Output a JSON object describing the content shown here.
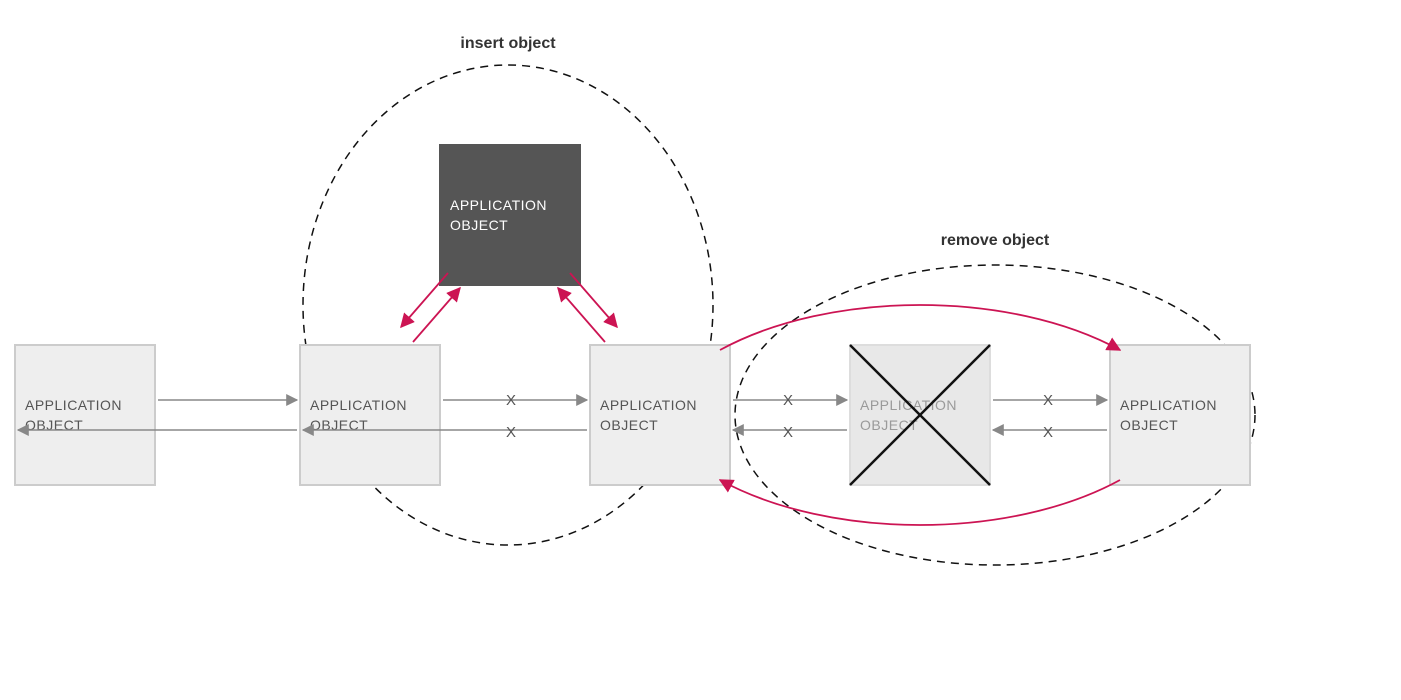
{
  "labels": {
    "insert": "insert object",
    "remove": "remove object",
    "node1_l1": "APPLICATION",
    "node1_l2": "OBJECT",
    "node2_l1": "APPLICATION",
    "node2_l2": "OBJECT",
    "node3_l1": "APPLICATION",
    "node3_l2": "OBJECT",
    "node4_l1": "APPLICATION",
    "node4_l2": "OBJECT",
    "node5_l1": "APPLICATION",
    "node5_l2": "OBJECT",
    "nodeNew_l1": "APPLICATION",
    "nodeNew_l2": "OBJECT",
    "nodeDel_l1": "APPLICATION",
    "nodeDel_l2": "OBJECT"
  },
  "marks": {
    "x": "X"
  },
  "colors": {
    "nodeFill": "#eeeeee",
    "nodeStroke": "#cccccc",
    "nodeDarkFill": "#555555",
    "nodeDeletedFill": "#e8e8e8",
    "arrowGray": "#888888",
    "arrowRed": "#cc1453",
    "dash": "#111111"
  },
  "diagram": {
    "description": "Doubly-linked list of application objects showing insert and remove operations.",
    "nodes": [
      {
        "id": "n1",
        "kind": "normal"
      },
      {
        "id": "n2",
        "kind": "normal"
      },
      {
        "id": "nNew",
        "kind": "inserted"
      },
      {
        "id": "n3",
        "kind": "normal"
      },
      {
        "id": "nDel",
        "kind": "removed"
      },
      {
        "id": "n5",
        "kind": "normal"
      }
    ],
    "links": [
      {
        "from": "n1",
        "to": "n2",
        "state": "active"
      },
      {
        "from": "n2",
        "to": "n1",
        "state": "active"
      },
      {
        "from": "n2",
        "to": "n3",
        "state": "broken"
      },
      {
        "from": "n3",
        "to": "n2",
        "state": "broken"
      },
      {
        "from": "n2",
        "to": "nNew",
        "state": "new"
      },
      {
        "from": "nNew",
        "to": "n2",
        "state": "new"
      },
      {
        "from": "nNew",
        "to": "n3",
        "state": "new"
      },
      {
        "from": "n3",
        "to": "nNew",
        "state": "new"
      },
      {
        "from": "n3",
        "to": "nDel",
        "state": "broken"
      },
      {
        "from": "nDel",
        "to": "n3",
        "state": "broken"
      },
      {
        "from": "nDel",
        "to": "n5",
        "state": "broken"
      },
      {
        "from": "n5",
        "to": "nDel",
        "state": "broken"
      },
      {
        "from": "n3",
        "to": "n5",
        "state": "new-bypass"
      },
      {
        "from": "n5",
        "to": "n3",
        "state": "new-bypass"
      }
    ],
    "groups": [
      {
        "label": "insert object",
        "around": [
          "n2",
          "nNew",
          "n3"
        ]
      },
      {
        "label": "remove object",
        "around": [
          "n3",
          "nDel",
          "n5"
        ]
      }
    ]
  }
}
